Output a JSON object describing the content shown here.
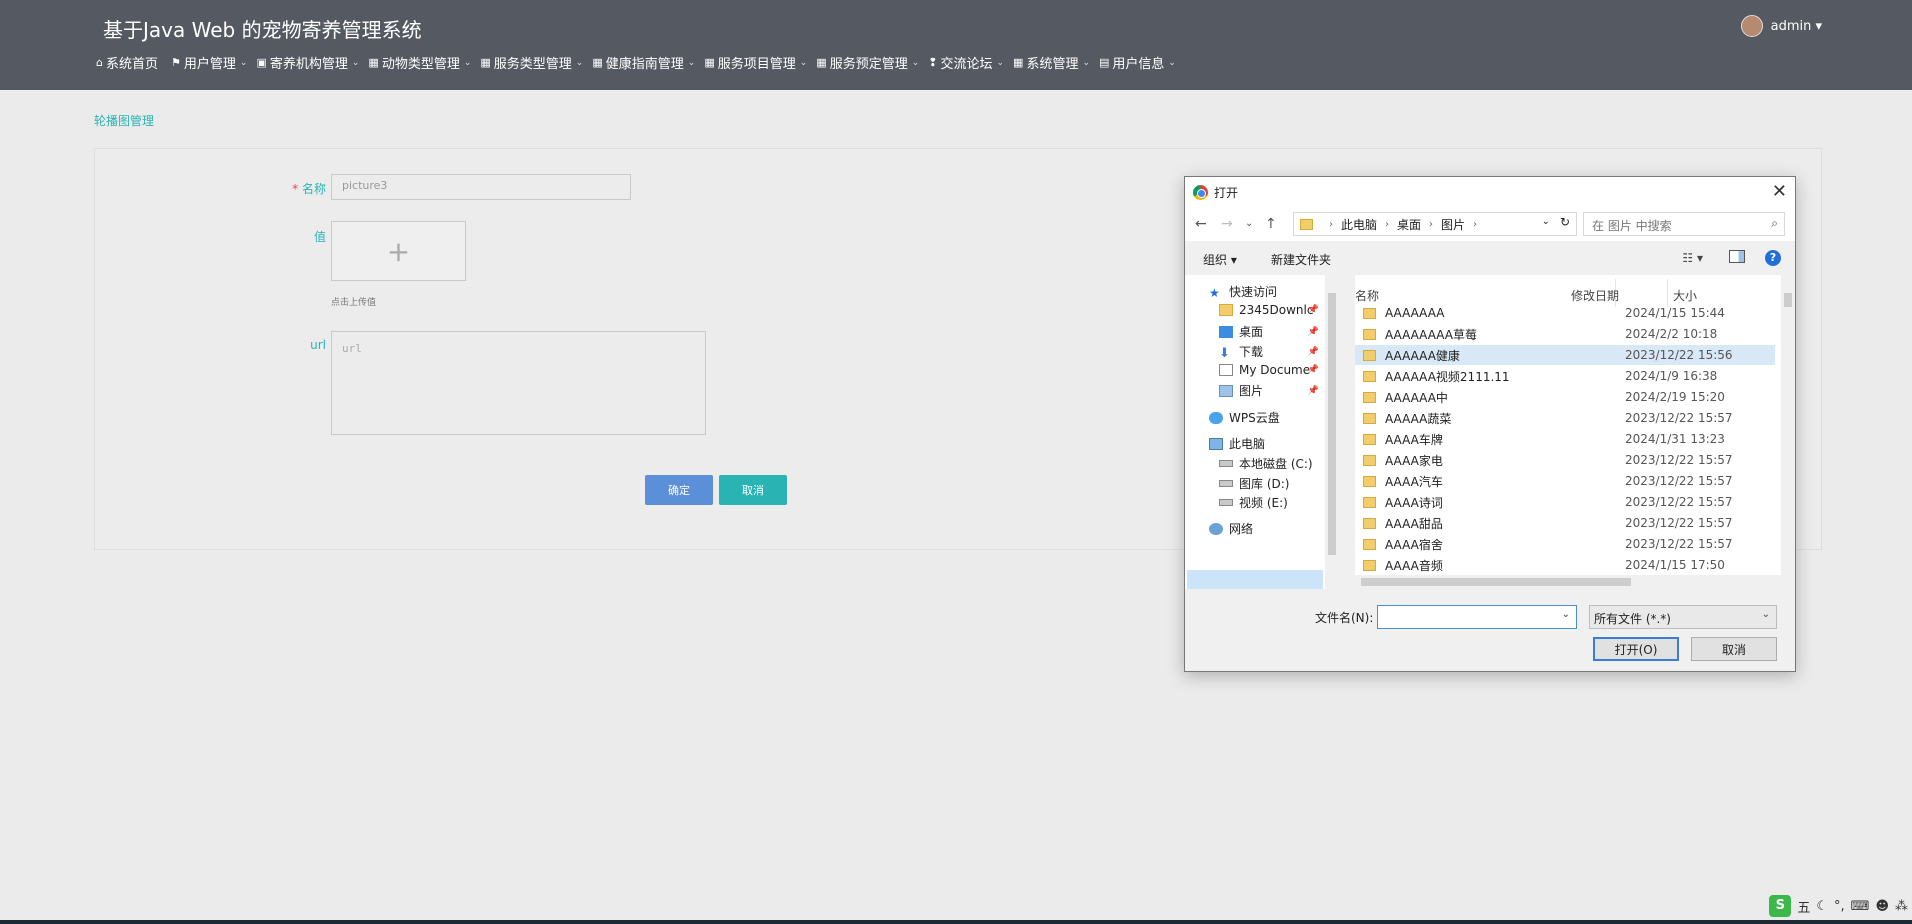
{
  "header": {
    "app_title": "基于Java Web 的宠物寄养管理系统",
    "user": "admin ▾",
    "nav": [
      {
        "icon": "⌂",
        "label": "系统首页",
        "caret": ""
      },
      {
        "icon": "⚑",
        "label": "用户管理",
        "caret": "⌄"
      },
      {
        "icon": "▣",
        "label": "寄养机构管理",
        "caret": "⌄"
      },
      {
        "icon": "▦",
        "label": "动物类型管理",
        "caret": "⌄"
      },
      {
        "icon": "▦",
        "label": "服务类型管理",
        "caret": "⌄"
      },
      {
        "icon": "▦",
        "label": "健康指南管理",
        "caret": "⌄"
      },
      {
        "icon": "▦",
        "label": "服务项目管理",
        "caret": "⌄"
      },
      {
        "icon": "▦",
        "label": "服务预定管理",
        "caret": "⌄"
      },
      {
        "icon": "❢",
        "label": "交流论坛",
        "caret": "⌄"
      },
      {
        "icon": "▦",
        "label": "系统管理",
        "caret": "⌄"
      },
      {
        "icon": "▤",
        "label": "用户信息",
        "caret": "⌄"
      }
    ]
  },
  "page": {
    "breadcrumb": "轮播图管理",
    "form": {
      "name_required": "*",
      "name_label": "名称",
      "name_value": "picture3",
      "value_label": "值",
      "upload_plus": "+",
      "upload_hint": "点击上传值",
      "url_label": "url",
      "url_placeholder": "url"
    },
    "buttons": {
      "ok": "确定",
      "cancel": "取消"
    }
  },
  "dialog": {
    "title": "打开",
    "close": "✕",
    "path": [
      "此电脑",
      "桌面",
      "图片"
    ],
    "search_placeholder": "在 图片 中搜索",
    "toolbar": {
      "organize": "组织 ▾",
      "new_folder": "新建文件夹",
      "help": "?"
    },
    "tree": [
      {
        "label": "快速访问",
        "icon": "star-icon",
        "pin": ""
      },
      {
        "label": "2345Downlc",
        "icon": "folder-icon",
        "pin": "📌"
      },
      {
        "label": "桌面",
        "icon": "desktop-icon",
        "pin": "📌"
      },
      {
        "label": "下载",
        "icon": "download-icon",
        "pin": "📌"
      },
      {
        "label": "My Docume",
        "icon": "document-icon",
        "pin": "📌"
      },
      {
        "label": "图片",
        "icon": "pictures-icon",
        "pin": "📌"
      },
      {
        "label": "WPS云盘",
        "icon": "cloud-icon",
        "pin": ""
      },
      {
        "label": "此电脑",
        "icon": "computer-icon",
        "pin": ""
      },
      {
        "label": "本地磁盘 (C:)",
        "icon": "drive-icon",
        "pin": ""
      },
      {
        "label": "图库 (D:)",
        "icon": "drive-icon",
        "pin": ""
      },
      {
        "label": "视频 (E:)",
        "icon": "drive-icon",
        "pin": ""
      },
      {
        "label": "网络",
        "icon": "network-icon",
        "pin": ""
      }
    ],
    "columns": {
      "name": "名称",
      "date": "修改日期",
      "size": "大小"
    },
    "files": [
      {
        "name": "AAAAAAA",
        "date": "2024/1/15 15:44"
      },
      {
        "name": "AAAAAAAA草莓",
        "date": "2024/2/2 10:18"
      },
      {
        "name": "AAAAAA健康",
        "date": "2023/12/22 15:56"
      },
      {
        "name": "AAAAAA视频2111.11",
        "date": "2024/1/9 16:38"
      },
      {
        "name": "AAAAAA中",
        "date": "2024/2/19 15:20"
      },
      {
        "name": "AAAAA蔬菜",
        "date": "2023/12/22 15:57"
      },
      {
        "name": "AAAA车牌",
        "date": "2024/1/31 13:23"
      },
      {
        "name": "AAAA家电",
        "date": "2023/12/22 15:57"
      },
      {
        "name": "AAAA汽车",
        "date": "2023/12/22 15:57"
      },
      {
        "name": "AAAA诗词",
        "date": "2023/12/22 15:57"
      },
      {
        "name": "AAAA甜品",
        "date": "2023/12/22 15:57"
      },
      {
        "name": "AAAA宿舍",
        "date": "2023/12/22 15:57"
      },
      {
        "name": "AAAA音频",
        "date": "2024/1/15 17:50"
      }
    ],
    "filename_label": "文件名(N):",
    "filename_value": "",
    "filetype": "所有文件 (*.*)",
    "open_button": "打开(O)",
    "cancel_button": "取消"
  },
  "tray": {
    "ime_logo": "S",
    "ime_mode": "五"
  }
}
